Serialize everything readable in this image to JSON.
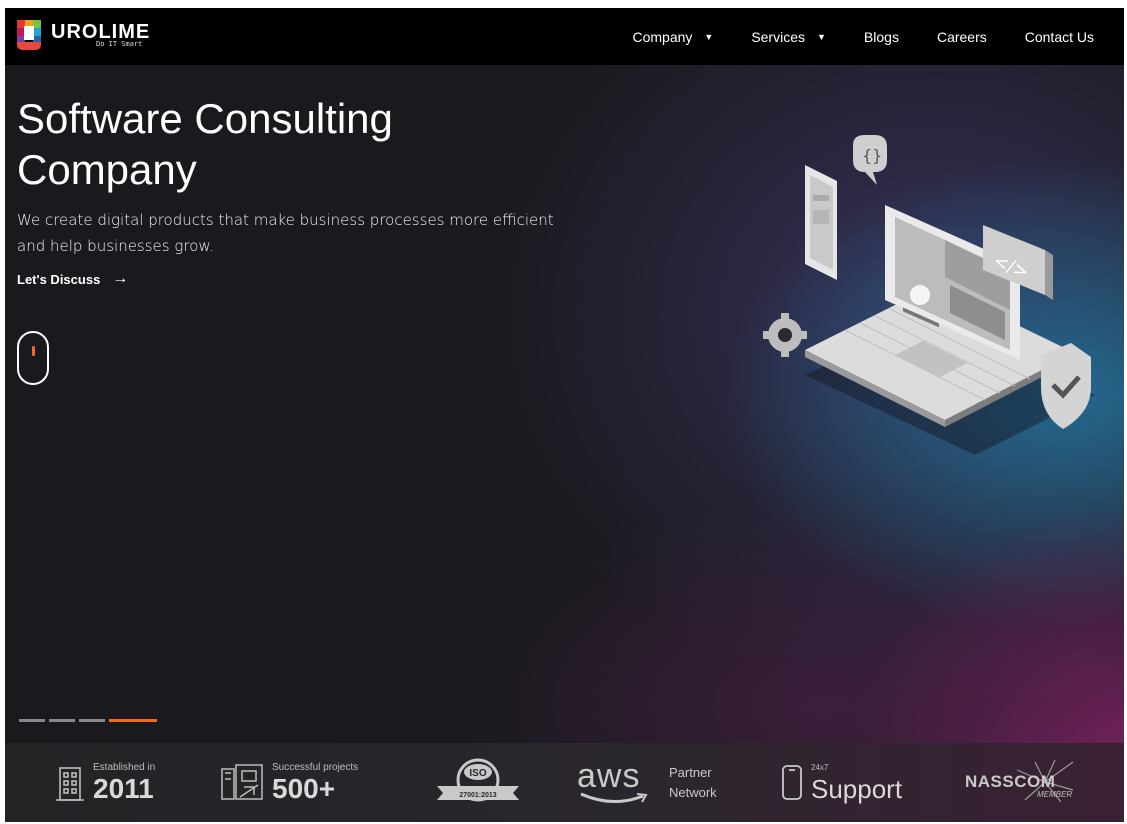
{
  "brand": {
    "name": "UROLIME",
    "tagline": "Do IT Smart"
  },
  "nav": {
    "items": [
      {
        "label": "Company",
        "has_dropdown": true
      },
      {
        "label": "Services",
        "has_dropdown": true
      },
      {
        "label": "Blogs",
        "has_dropdown": false
      },
      {
        "label": "Careers",
        "has_dropdown": false
      },
      {
        "label": "Contact Us",
        "has_dropdown": false
      }
    ]
  },
  "hero": {
    "title_line1": "Software Consulting",
    "title_line2": "Company",
    "description_line1": "We create digital products that make business processes more efficient",
    "description_line2": "and help businesses grow.",
    "cta_label": "Let's Discuss",
    "cta_arrow": "→",
    "slides_total": 4,
    "active_slide": 4
  },
  "stats": {
    "established_label": "Established in",
    "established_value": "2011",
    "projects_label": "Successful projects",
    "projects_value": "500+",
    "iso_top": "ISO",
    "iso_bottom": "27001:2013",
    "aws_logo": "aws",
    "aws_label_1": "Partner",
    "aws_label_2": "Network",
    "support_small": "24x7",
    "support_label": "Support",
    "nasscom_label": "NASSCOM",
    "nasscom_sub": "MEMBER"
  },
  "colors": {
    "accent": "#f26b21",
    "header_bg": "#000000",
    "hero_bg": "#1a1a1e"
  }
}
